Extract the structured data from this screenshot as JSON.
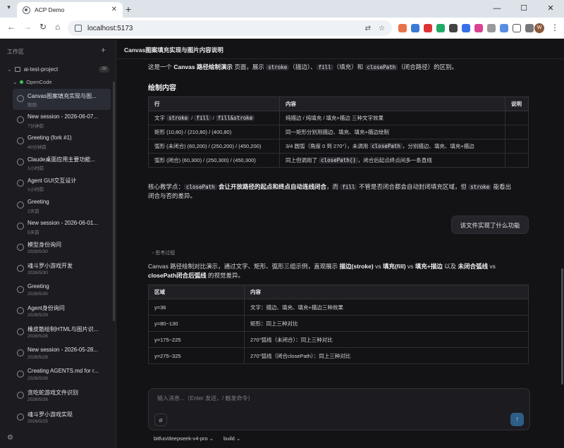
{
  "browser": {
    "tab_title": "ACP Demo",
    "url": "localhost:5173",
    "avatar_letter": "W"
  },
  "sidebar": {
    "header": "工作区",
    "project": {
      "name": "ai-test-project",
      "badge": "38"
    },
    "agent": "OpenCode",
    "sessions": [
      {
        "title": "Canvas图案填充实现与图...",
        "sub": "刚刚"
      },
      {
        "title": "New session - 2026-06-07...",
        "sub": "7分钟前"
      },
      {
        "title": "Greeting (fork #1)",
        "sub": "40分钟前"
      },
      {
        "title": "Claude桌面应用主要功能...",
        "sub": "1小时前"
      },
      {
        "title": "Agent GUI交互设计",
        "sub": "1小时前"
      },
      {
        "title": "Greeting",
        "sub": "2天前"
      },
      {
        "title": "New session - 2026-06-01...",
        "sub": "5天前"
      },
      {
        "title": "模型身份询问",
        "sub": "2026/5/30"
      },
      {
        "title": "魂斗罗小游戏开发",
        "sub": "2026/5/30"
      },
      {
        "title": "Greeting",
        "sub": "2026/5/30"
      },
      {
        "title": "Agent身份询问",
        "sub": "2026/5/29"
      },
      {
        "title": "橡皮筋绘制HTML与图片识...",
        "sub": "2026/5/28"
      },
      {
        "title": "New session - 2026-05-28...",
        "sub": "2026/5/28"
      },
      {
        "title": "Creating AGENTS.md for r...",
        "sub": "2026/5/28"
      },
      {
        "title": "贪吃蛇游戏文件识别",
        "sub": "2026/5/26"
      },
      {
        "title": "魂斗罗小游戏实现",
        "sub": "2026/5/25"
      }
    ]
  },
  "main": {
    "title": "Canvas图案填充实现与图片内容说明",
    "intro": {
      "a": "这是一个 ",
      "b": "Canvas 路径绘制演示",
      "c": " 页面，展示 ",
      "code1": "stroke",
      "d": "（描边）、",
      "code2": "fill",
      "e": "（填充）和 ",
      "code3": "closePath",
      "f": "（闭合路径）的区别。"
    },
    "heading": "绘制内容",
    "table1": {
      "headers": [
        "行",
        "内容",
        "说明"
      ],
      "rows": [
        {
          "c1a": "文字 ",
          "c1code1": "stroke",
          "c1b": " / ",
          "c1code2": "fill",
          "c1c": " / ",
          "c1code3": "fill&stroke",
          "c2": "纯描边 / 纯填充 / 填充+描边 三种文字效果"
        },
        {
          "c1": "矩形 (10,80) / (210,80) / (400,80)",
          "c2": "同一矩形分别用描边、填充、填充+描边绘制"
        },
        {
          "c1": "弧形 (未闭合) (60,200) / (250,200) / (450,200)",
          "c2a": "3/4 圆弧（角度 0 到 270°），未调用 ",
          "c2code": "closePath",
          "c2b": "，分别描边、填充、填充+描边"
        },
        {
          "c1": "弧形 (闭合) (60,300) / (250,300) / (450,300)",
          "c2a": "同上但调用了 ",
          "c2code": "closePath()",
          "c2b": "，闭合后起点终点间多一条直线"
        }
      ]
    },
    "core": {
      "a": "核心教学点：",
      "code1": "closePath",
      "b": " 会让开放路径的起点和终点自动连线闭合",
      "c": "，而 ",
      "code2": "fill",
      "d": " 不管是否闭合都会自动封闭填充区域，但 ",
      "code3": "stroke",
      "e": " 能看出",
      "f": "闭合与否的差异。"
    },
    "user_message": "该文件实现了什么功能",
    "thinking": "思考过程",
    "answer": {
      "a": "Canvas 路径绘制对比演示，通过文字、矩形、弧形三组示例，直观展示 ",
      "b": "描边(stroke)",
      "c": " vs ",
      "d": "填充(fill)",
      "e": " vs ",
      "f": "填充+描边",
      "g": " 以及 ",
      "h": "未闭合弧线",
      "i": " vs",
      "j": "closePath闭合后弧线",
      "k": " 的视觉差异。"
    },
    "table2": {
      "headers": [
        "区域",
        "内容"
      ],
      "rows": [
        {
          "c1": "y=36",
          "c2": "文字：描边、填充、填充+描边三种效果"
        },
        {
          "c1": "y=80~130",
          "c2": "矩形：同上三种对比"
        },
        {
          "c1": "y=175~225",
          "c2": "270°弧线（未闭合）：同上三种对比"
        },
        {
          "c1": "y=275~325",
          "c2": "270°弧线（闭合closePath）：同上三种对比"
        }
      ]
    },
    "input_placeholder": "输入消息...（Enter 发送，/ 触发命令）",
    "model": "bitfun/deepseek-v4-pro",
    "mode": "build"
  }
}
